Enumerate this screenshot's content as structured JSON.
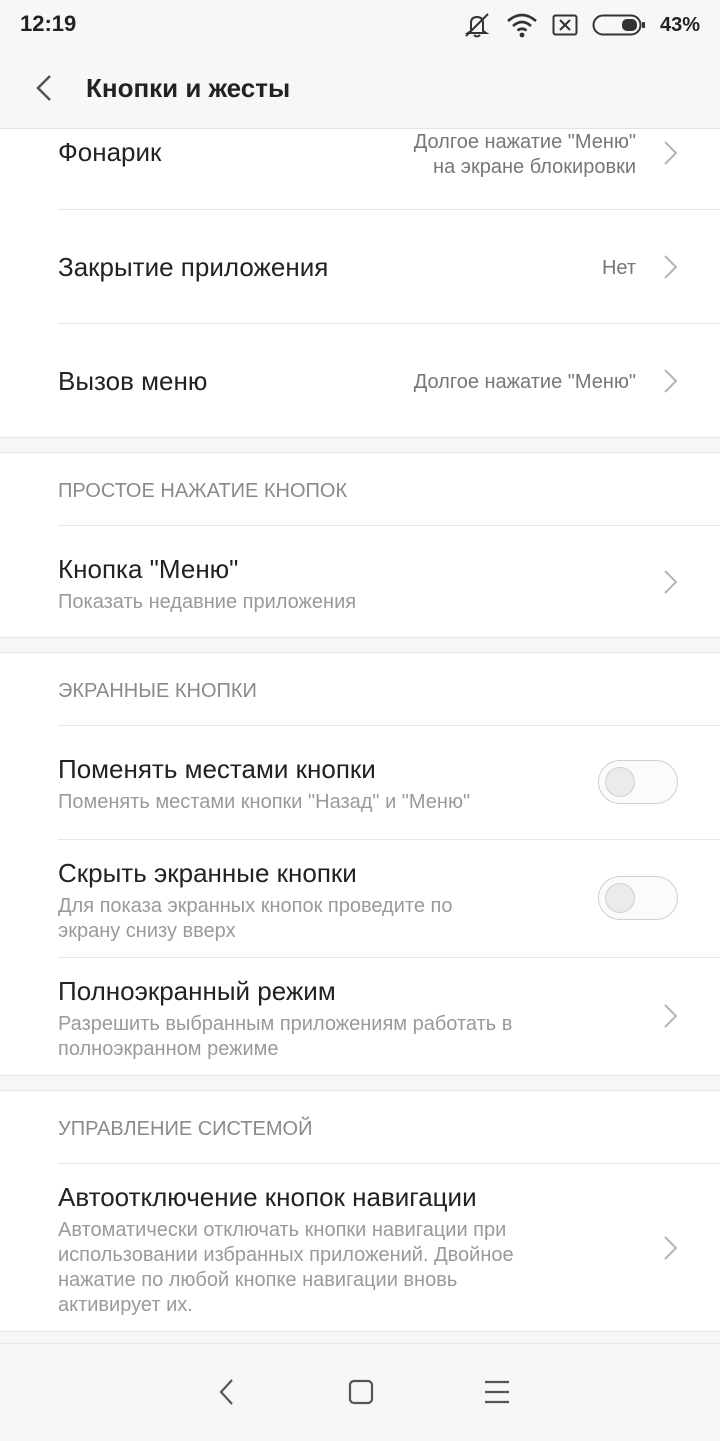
{
  "status_bar": {
    "time": "12:19",
    "battery_percent": "43%",
    "icons": [
      "bell-muted-icon",
      "wifi-icon",
      "no-sim-icon",
      "battery-icon"
    ]
  },
  "header": {
    "title": "Кнопки и жесты",
    "back_icon": "chevron-left-icon"
  },
  "group1": {
    "rows": [
      {
        "title": "Фонарик",
        "value_line1": "Долгое нажатие \"Меню\"",
        "value_line2": "на экране блокировки"
      },
      {
        "title": "Закрытие приложения",
        "value": "Нет"
      },
      {
        "title": "Вызов меню",
        "value": "Долгое нажатие \"Меню\""
      }
    ]
  },
  "group2": {
    "section_title": "ПРОСТОЕ НАЖАТИЕ КНОПОК",
    "rows": [
      {
        "title": "Кнопка \"Меню\"",
        "subtitle": "Показать недавние приложения"
      }
    ]
  },
  "group3": {
    "section_title": "ЭКРАННЫЕ КНОПКИ",
    "rows": [
      {
        "title": "Поменять местами кнопки",
        "subtitle": "Поменять местами кнопки \"Назад\" и \"Меню\"",
        "toggle_on": false
      },
      {
        "title": "Скрыть экранные кнопки",
        "subtitle_line1": "Для показа экранных кнопок проведите по",
        "subtitle_line2": "экрану снизу вверх",
        "toggle_on": false
      },
      {
        "title": "Полноэкранный режим",
        "subtitle_line1": "Разрешить выбранным приложениям работать в",
        "subtitle_line2": "полноэкранном режиме"
      }
    ]
  },
  "group4": {
    "section_title": "УПРАВЛЕНИЕ СИСТЕМОЙ",
    "rows": [
      {
        "title": "Автоотключение кнопок навигации",
        "subtitle_lines": [
          "Автоматически отключать кнопки навигации при",
          "использовании избранных приложений. Двойное",
          "нажатие по любой кнопке навигации вновь",
          "активирует их."
        ]
      }
    ]
  },
  "nav_bar": {
    "icons": [
      "nav-back-icon",
      "nav-home-icon",
      "nav-menu-icon"
    ]
  },
  "colors": {
    "background": "#f7f7f7",
    "card": "#ffffff",
    "title_text": "#222222",
    "secondary_text": "#9a9a9a",
    "divider": "#e6e6e6"
  }
}
